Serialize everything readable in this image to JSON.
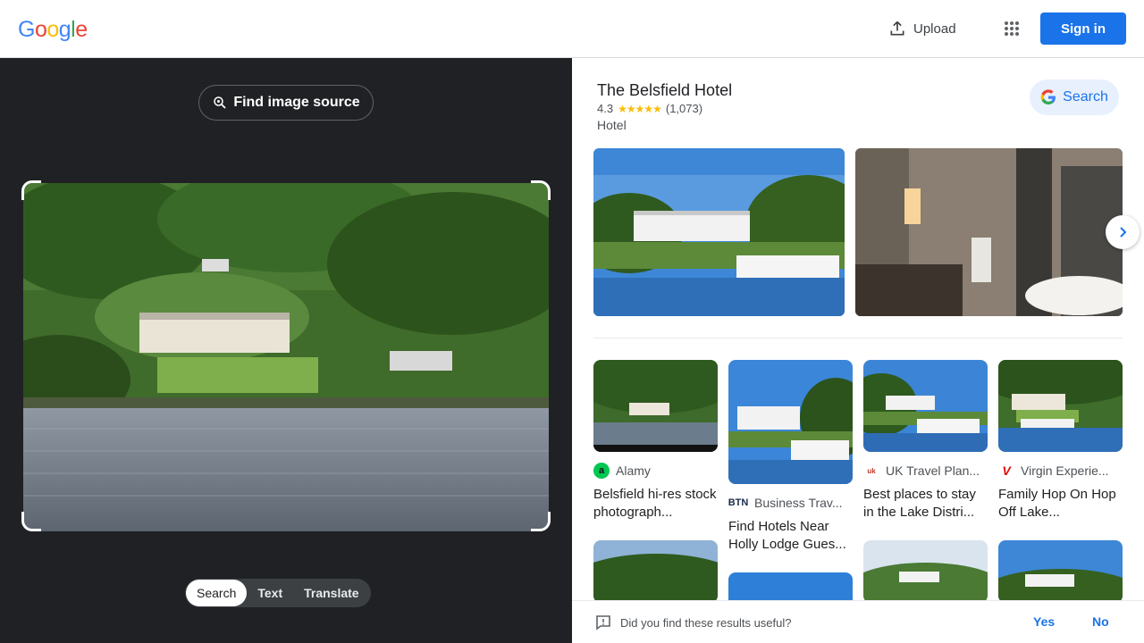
{
  "header": {
    "logo": [
      "G",
      "o",
      "o",
      "g",
      "l",
      "e"
    ],
    "logo_colors": [
      "#4285f4",
      "#ea4335",
      "#fbbc05",
      "#4285f4",
      "#34a853",
      "#ea4335"
    ],
    "upload_label": "Upload",
    "apps_icon": "apps-grid-icon",
    "signin_label": "Sign in"
  },
  "left": {
    "find_source_label": "Find image source",
    "tabs": [
      "Search",
      "Text",
      "Translate"
    ],
    "active_tab": "Search"
  },
  "entity": {
    "title": "The Belsfield Hotel",
    "rating": "4.3",
    "stars": "★★★★★",
    "reviews": "(1,073)",
    "type": "Hotel",
    "search_label": "Search"
  },
  "results": [
    {
      "source": "Alamy",
      "icon_text": "a",
      "icon_color": "#00b050",
      "caption": "Belsfield hi-res stock photograph..."
    },
    {
      "source": "Business Trav...",
      "icon_text": "BTN",
      "icon_color": "#1a2a4a",
      "caption": "Find Hotels Near Holly Lodge Gues..."
    },
    {
      "source": "UK Travel Plan...",
      "icon_text": "uk",
      "icon_color": "#c0392b",
      "caption": "Best places to stay in the Lake Distri..."
    },
    {
      "source": "Virgin Experie...",
      "icon_text": "V",
      "icon_color": "#e10a0a",
      "caption": "Family Hop On Hop Off Lake..."
    }
  ],
  "feedback": {
    "question": "Did you find these results useful?",
    "yes": "Yes",
    "no": "No"
  },
  "colors": {
    "accent": "#1a73e8",
    "dark_pane": "#202124",
    "star": "#fbbc04"
  }
}
